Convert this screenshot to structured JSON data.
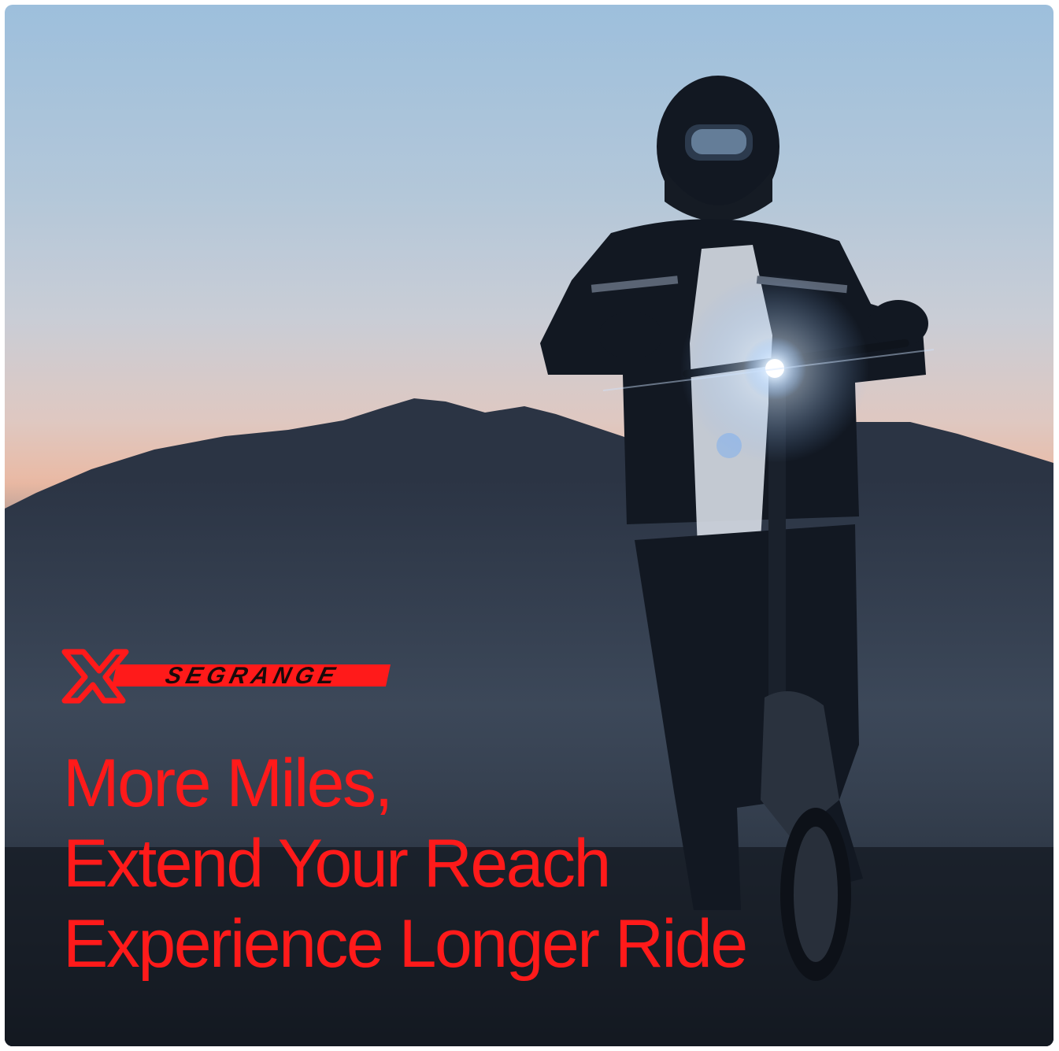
{
  "brand": {
    "name": "SEGRANGE",
    "accent_color": "#ff1a1a"
  },
  "headline": {
    "line1": "More Miles,",
    "line2": "Extend Your Reach",
    "line3": "Experience Longer Ride"
  },
  "icons": {
    "logo": "x-crossed-logo-icon"
  }
}
